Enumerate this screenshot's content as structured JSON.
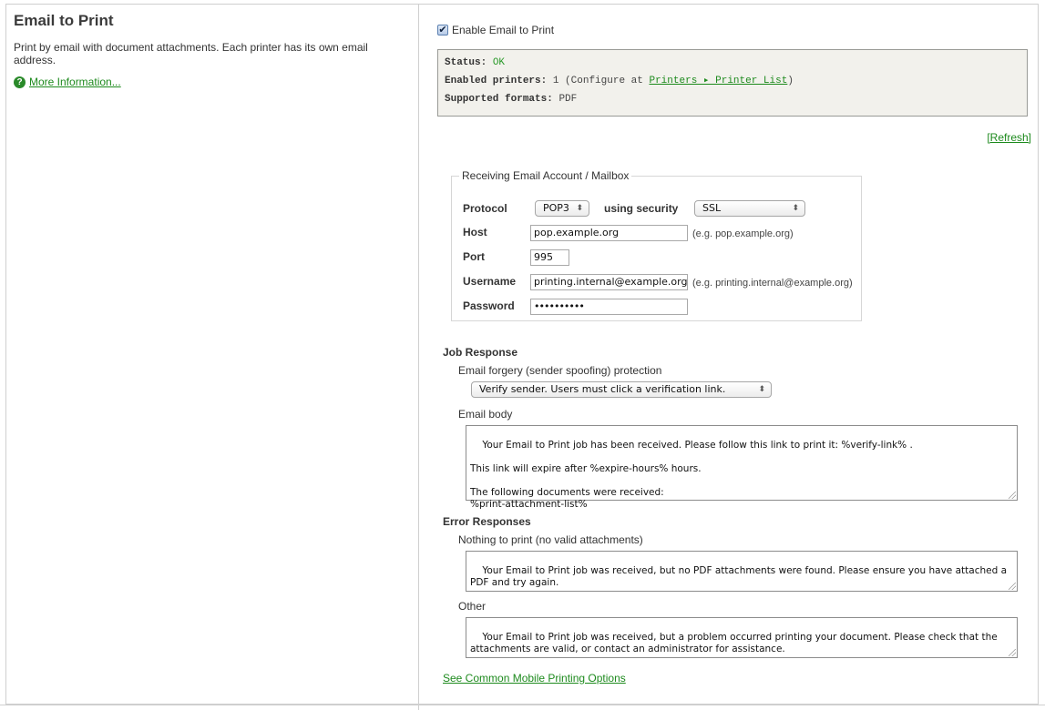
{
  "left": {
    "title": "Email to Print",
    "description": "Print by email with document attachments. Each printer has its own email address.",
    "more_info_label": "More Information...",
    "help_icon": "question-circle-icon"
  },
  "enable": {
    "label": "Enable Email to Print",
    "checked": true
  },
  "status": {
    "status_label": "Status:",
    "status_value": "OK",
    "status_color": "#2a9a2a",
    "printers_label": "Enabled printers:",
    "printers_value": "1",
    "configure_prefix": "(Configure at",
    "configure_link": "Printers ▸ Printer List",
    "configure_suffix": ")",
    "formats_label": "Supported formats:",
    "formats_value": "PDF"
  },
  "refresh_label": "[Refresh]",
  "mailbox": {
    "legend": "Receiving Email Account / Mailbox",
    "protocol_label": "Protocol",
    "protocol_value": "POP3",
    "security_label": "using security",
    "security_value": "SSL",
    "host_label": "Host",
    "host_value": "pop.example.org",
    "host_hint": "(e.g. pop.example.org)",
    "port_label": "Port",
    "port_value": "995",
    "username_label": "Username",
    "username_value": "printing.internal@example.org",
    "username_hint": "(e.g. printing.internal@example.org)",
    "password_label": "Password",
    "password_value": "••••••••••"
  },
  "job_response": {
    "title": "Job Response",
    "forgery_label": "Email forgery (sender spoofing) protection",
    "forgery_value": "Verify sender. Users must click a verification link.",
    "body_label": "Email body",
    "body_value": "Your Email to Print job has been received. Please follow this link to print it: %verify-link% .\n\nThis link will expire after %expire-hours% hours.\n\nThe following documents were received:\n%print-attachment-list%"
  },
  "error_responses": {
    "title": "Error Responses",
    "nothing_label": "Nothing to print (no valid attachments)",
    "nothing_value": "Your Email to Print job was received, but no PDF attachments were found. Please ensure you have attached a PDF and try again.",
    "other_label": "Other",
    "other_value": "Your Email to Print job was received, but a problem occurred printing your document. Please check that the attachments are valid, or contact an administrator for assistance."
  },
  "mobile_link": "See Common Mobile Printing Options",
  "colors": {
    "link": "#1d8a1d",
    "status_bg": "#f2f1ec",
    "border": "#cfcfcf"
  }
}
